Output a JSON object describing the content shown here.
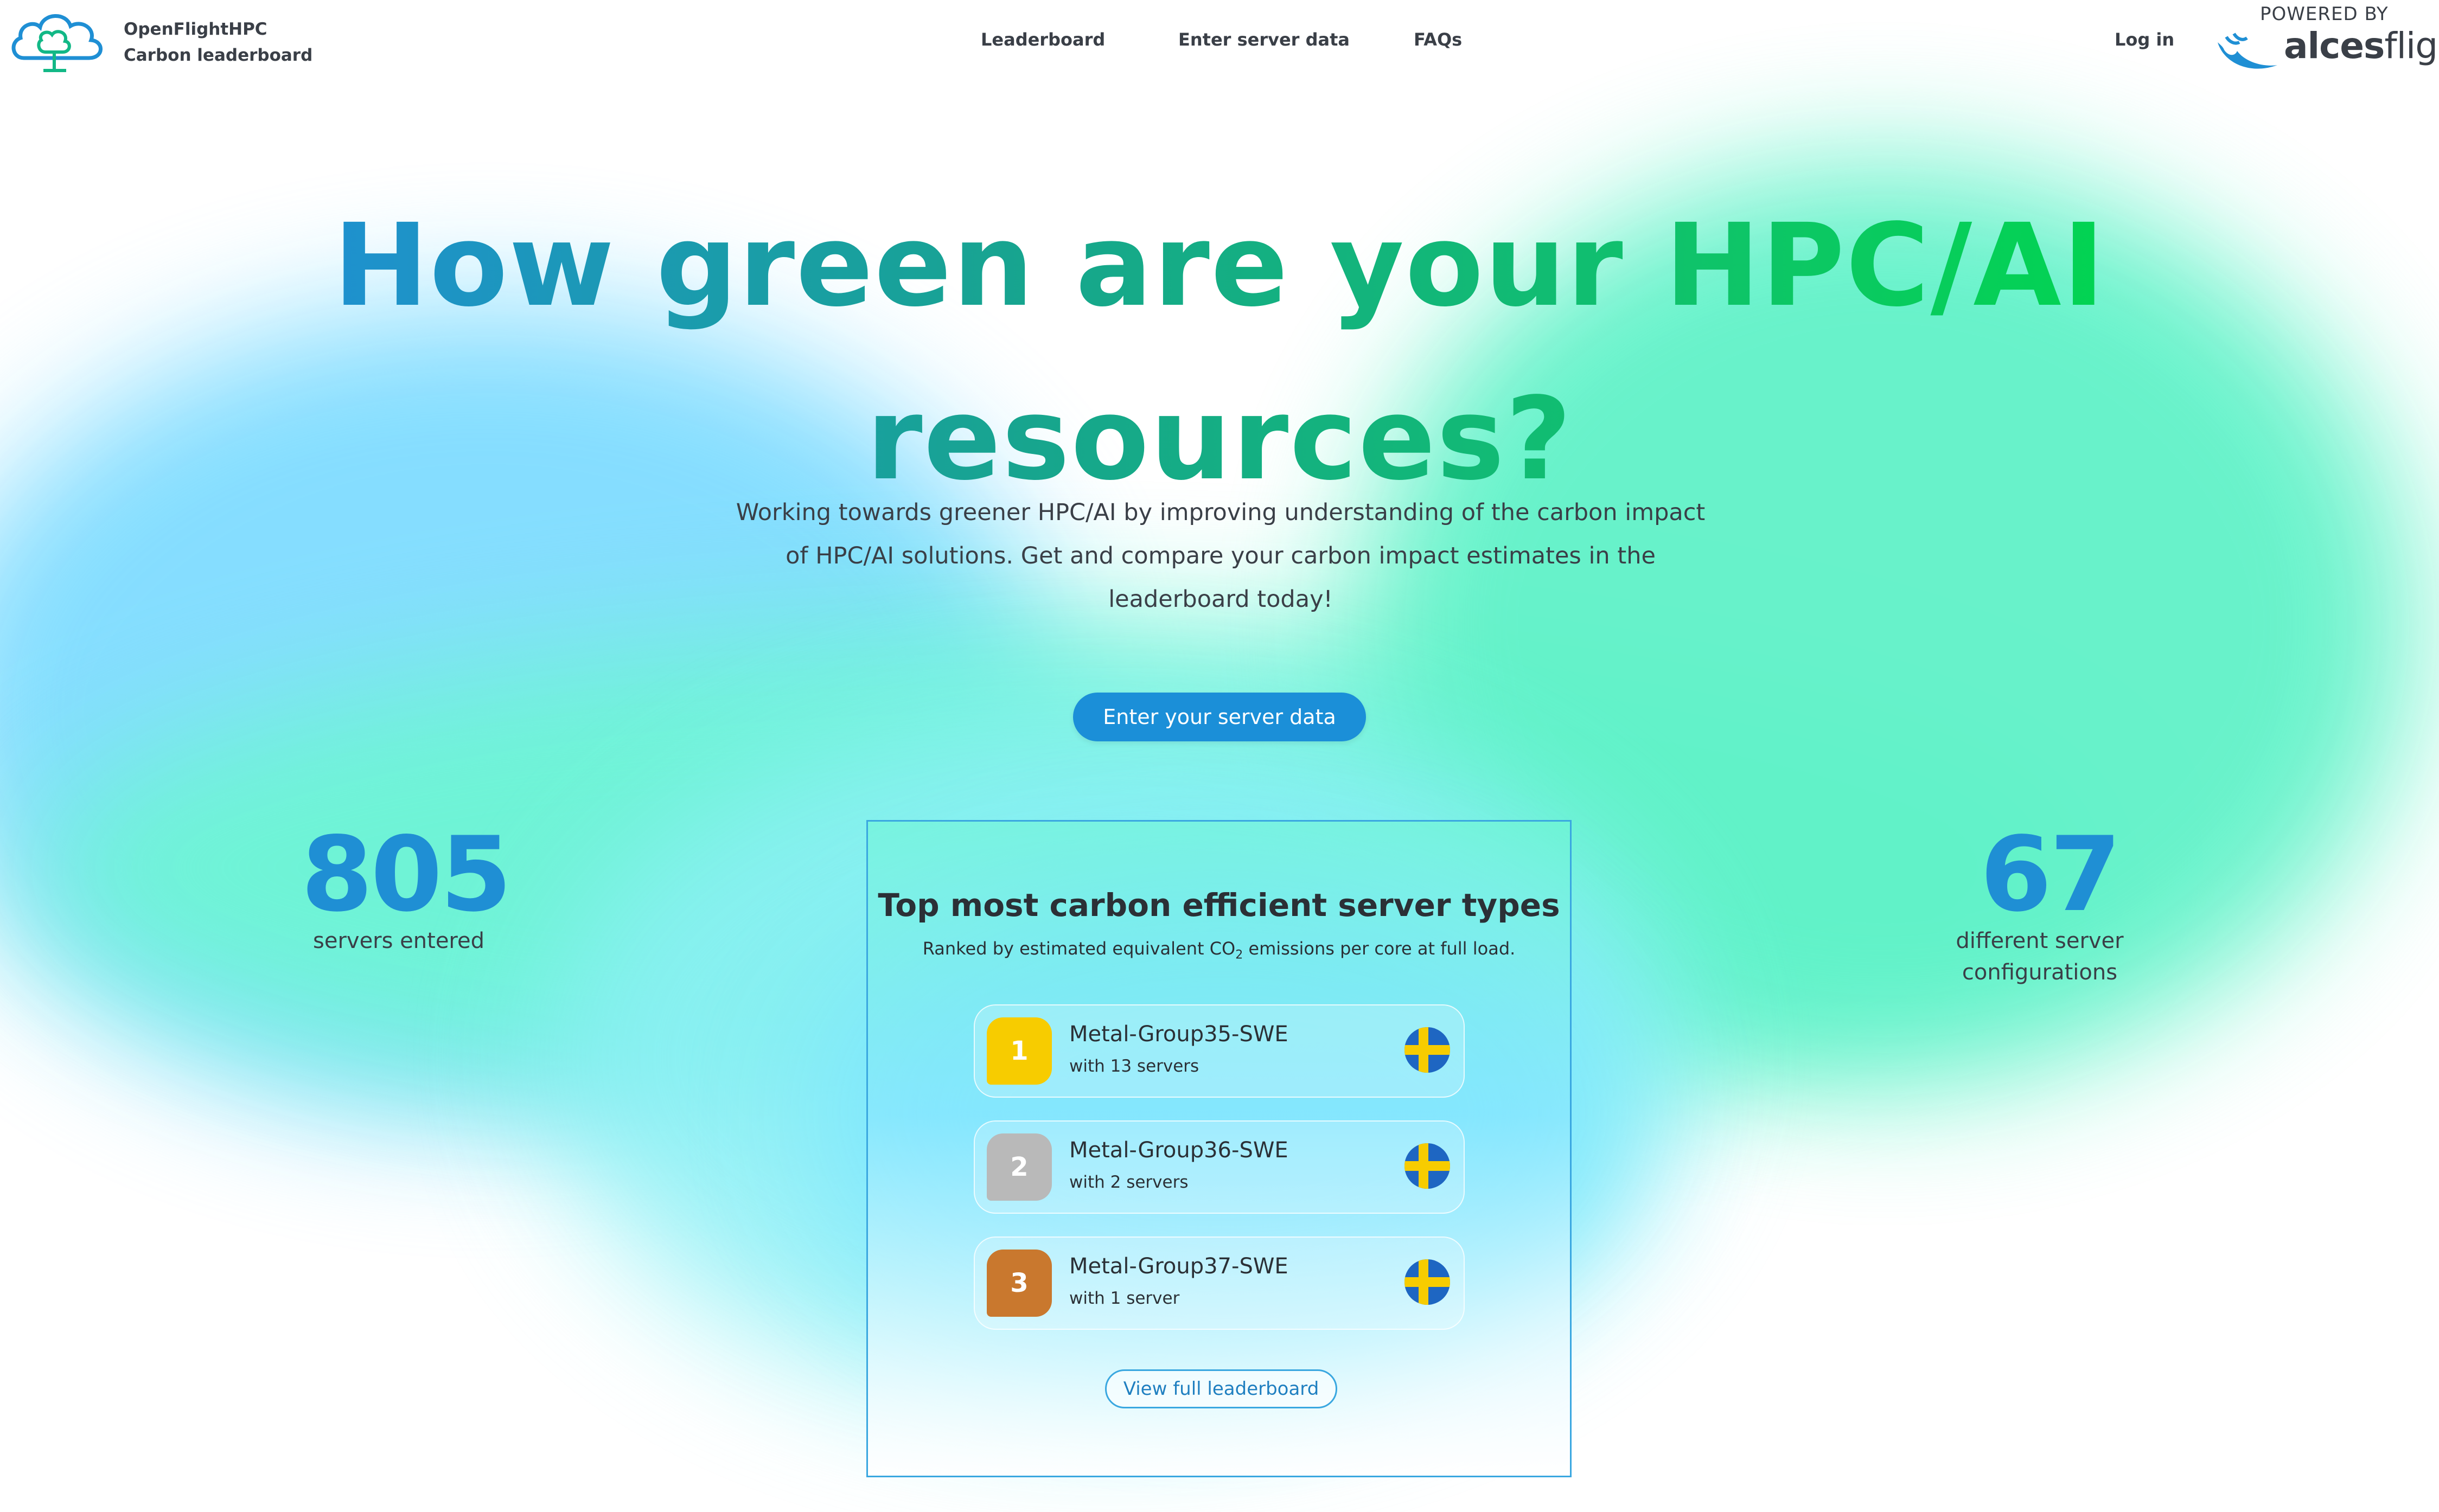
{
  "brand": {
    "line1": "OpenFlightHPC",
    "line2": "Carbon leaderboard"
  },
  "nav": [
    {
      "label": "Leaderboard"
    },
    {
      "label": "Enter server data"
    },
    {
      "label": "FAQs"
    }
  ],
  "auth": {
    "login_label": "Log in"
  },
  "powered_by": {
    "label": "POWERED BY",
    "logo_bold": "alces",
    "logo_light": "flight"
  },
  "hero": {
    "title_line1": "How green are your HPC/AI",
    "title_line2": "resources?",
    "description": "Working towards greener HPC/AI by improving understanding of the carbon impact of HPC/AI solutions. Get and compare your carbon impact estimates in the leaderboard today!",
    "cta_label": "Enter your server data"
  },
  "stats": {
    "left": {
      "value": "805",
      "label": "servers entered"
    },
    "right": {
      "value": "67",
      "label": "different server configurations"
    }
  },
  "leaderboard": {
    "title": "Top most carbon efficient server types",
    "subtitle_pre": "Ranked by estimated equivalent CO",
    "subtitle_sub": "2",
    "subtitle_post": " emissions per core at full load.",
    "entries": [
      {
        "rank": "1",
        "name": "Metal-Group35-SWE",
        "count": "with 13 servers",
        "badge_color": "#f7cc00"
      },
      {
        "rank": "2",
        "name": "Metal-Group36-SWE",
        "count": "with 2 servers",
        "badge_color": "#b9b9b9"
      },
      {
        "rank": "3",
        "name": "Metal-Group37-SWE",
        "count": "with 1 server",
        "badge_color": "#c9782e"
      }
    ],
    "view_all_label": "View full leaderboard"
  },
  "colors": {
    "primary": "#1b8fd8",
    "accent_green": "#00d64e",
    "text": "#3a3f47"
  }
}
